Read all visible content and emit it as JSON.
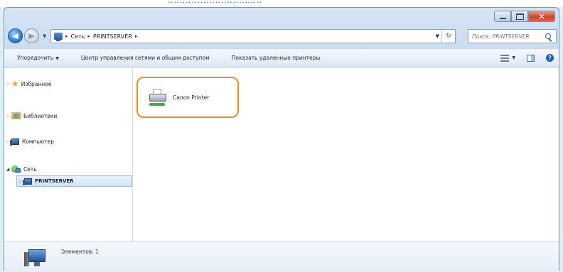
{
  "top_strip_text": "‥‥‥‥‥‥‥‥‥‥‥‥‥‥‥‥",
  "window": {
    "caption_buttons": {
      "minimize": "",
      "maximize": "",
      "close": "✕"
    }
  },
  "address": {
    "crumbs": [
      "Сеть",
      "PRINTSERVER"
    ],
    "search_placeholder": "Поиск: PRINTSERVER"
  },
  "toolbar": {
    "organize_label": "Упорядочить",
    "network_center_label": "Центр управления сетями и общим доступом",
    "show_printers_label": "Показать удаленные принтеры"
  },
  "sidebar": {
    "items": [
      {
        "label": "Избранное"
      },
      {
        "label": "Библиотеки"
      },
      {
        "label": "Компьютер"
      },
      {
        "label": "Сеть"
      },
      {
        "label": "PRINTSERVER"
      }
    ]
  },
  "files": [
    {
      "label": "Canon Printer"
    }
  ],
  "details": {
    "count_text": "Элементов: 1"
  }
}
